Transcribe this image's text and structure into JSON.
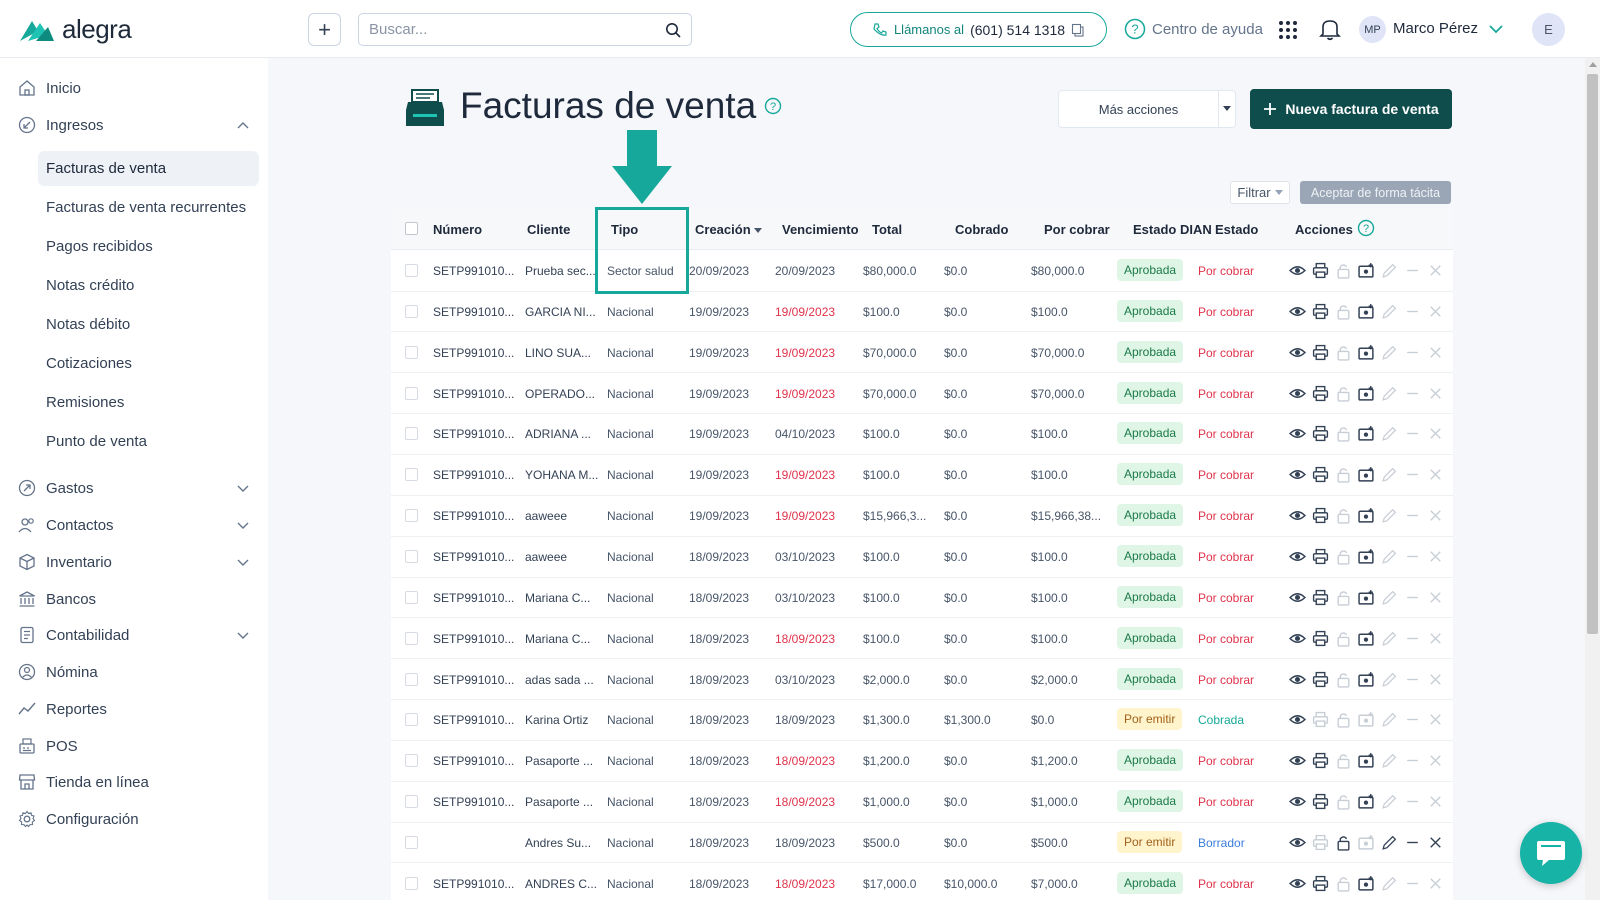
{
  "app": {
    "brand": "alegra"
  },
  "topbar": {
    "search_placeholder": "Buscar...",
    "call_label": "Llámanos al",
    "call_number": "(601) 514 1318",
    "help_label": "Centro de ayuda",
    "user_initials": "MP",
    "user_name": "Marco Pérez",
    "avatar_initial": "E"
  },
  "sidebar": {
    "items": [
      {
        "label": "Inicio",
        "icon": "home-icon"
      },
      {
        "label": "Ingresos",
        "icon": "income-icon",
        "expanded": true
      },
      {
        "label": "Gastos",
        "icon": "expense-icon"
      },
      {
        "label": "Contactos",
        "icon": "contacts-icon"
      },
      {
        "label": "Inventario",
        "icon": "inventory-icon"
      },
      {
        "label": "Bancos",
        "icon": "bank-icon"
      },
      {
        "label": "Contabilidad",
        "icon": "accounting-icon"
      },
      {
        "label": "Nómina",
        "icon": "payroll-icon"
      },
      {
        "label": "Reportes",
        "icon": "reports-icon"
      },
      {
        "label": "POS",
        "icon": "pos-icon"
      },
      {
        "label": "Tienda en línea",
        "icon": "store-icon"
      },
      {
        "label": "Configuración",
        "icon": "settings-icon"
      }
    ],
    "sub_items": [
      "Facturas de venta",
      "Facturas de venta recurrentes",
      "Pagos recibidos",
      "Notas crédito",
      "Notas débito",
      "Cotizaciones",
      "Remisiones",
      "Punto de venta"
    ],
    "active_sub": "Facturas de venta"
  },
  "page": {
    "title": "Facturas de venta",
    "more_actions": "Más acciones",
    "new_invoice": "Nueva factura de venta",
    "filter": "Filtrar",
    "tacit": "Aceptar de forma tácita"
  },
  "table": {
    "headers": [
      "Número",
      "Cliente",
      "Tipo",
      "Creación",
      "Vencimiento",
      "Total",
      "Cobrado",
      "Por cobrar",
      "Estado DIAN",
      "Estado",
      "Acciones"
    ],
    "rows": [
      {
        "numero": "SETP991010...",
        "cliente": "Prueba sec...",
        "tipo": "Sector salud",
        "creacion": "20/09/2023",
        "vencimiento": "20/09/2023",
        "venc_overdue": false,
        "total": "$80,000.0",
        "cobrado": "$0.0",
        "por_cobrar": "$80,000.0",
        "dian": "Aprobada",
        "estado": "Por cobrar"
      },
      {
        "numero": "SETP991010...",
        "cliente": "GARCIA NI...",
        "tipo": "Nacional",
        "creacion": "19/09/2023",
        "vencimiento": "19/09/2023",
        "venc_overdue": true,
        "total": "$100.0",
        "cobrado": "$0.0",
        "por_cobrar": "$100.0",
        "dian": "Aprobada",
        "estado": "Por cobrar"
      },
      {
        "numero": "SETP991010...",
        "cliente": "LINO SUA...",
        "tipo": "Nacional",
        "creacion": "19/09/2023",
        "vencimiento": "19/09/2023",
        "venc_overdue": true,
        "total": "$70,000.0",
        "cobrado": "$0.0",
        "por_cobrar": "$70,000.0",
        "dian": "Aprobada",
        "estado": "Por cobrar"
      },
      {
        "numero": "SETP991010...",
        "cliente": "OPERADO...",
        "tipo": "Nacional",
        "creacion": "19/09/2023",
        "vencimiento": "19/09/2023",
        "venc_overdue": true,
        "total": "$70,000.0",
        "cobrado": "$0.0",
        "por_cobrar": "$70,000.0",
        "dian": "Aprobada",
        "estado": "Por cobrar"
      },
      {
        "numero": "SETP991010...",
        "cliente": "ADRIANA ...",
        "tipo": "Nacional",
        "creacion": "19/09/2023",
        "vencimiento": "04/10/2023",
        "venc_overdue": false,
        "total": "$100.0",
        "cobrado": "$0.0",
        "por_cobrar": "$100.0",
        "dian": "Aprobada",
        "estado": "Por cobrar"
      },
      {
        "numero": "SETP991010...",
        "cliente": "YOHANA M...",
        "tipo": "Nacional",
        "creacion": "19/09/2023",
        "vencimiento": "19/09/2023",
        "venc_overdue": true,
        "total": "$100.0",
        "cobrado": "$0.0",
        "por_cobrar": "$100.0",
        "dian": "Aprobada",
        "estado": "Por cobrar"
      },
      {
        "numero": "SETP991010...",
        "cliente": "aaweee",
        "tipo": "Nacional",
        "creacion": "19/09/2023",
        "vencimiento": "19/09/2023",
        "venc_overdue": true,
        "total": "$15,966,3...",
        "cobrado": "$0.0",
        "por_cobrar": "$15,966,38...",
        "dian": "Aprobada",
        "estado": "Por cobrar"
      },
      {
        "numero": "SETP991010...",
        "cliente": "aaweee",
        "tipo": "Nacional",
        "creacion": "18/09/2023",
        "vencimiento": "03/10/2023",
        "venc_overdue": false,
        "total": "$100.0",
        "cobrado": "$0.0",
        "por_cobrar": "$100.0",
        "dian": "Aprobada",
        "estado": "Por cobrar"
      },
      {
        "numero": "SETP991010...",
        "cliente": "Mariana C...",
        "tipo": "Nacional",
        "creacion": "18/09/2023",
        "vencimiento": "03/10/2023",
        "venc_overdue": false,
        "total": "$100.0",
        "cobrado": "$0.0",
        "por_cobrar": "$100.0",
        "dian": "Aprobada",
        "estado": "Por cobrar"
      },
      {
        "numero": "SETP991010...",
        "cliente": "Mariana C...",
        "tipo": "Nacional",
        "creacion": "18/09/2023",
        "vencimiento": "18/09/2023",
        "venc_overdue": true,
        "total": "$100.0",
        "cobrado": "$0.0",
        "por_cobrar": "$100.0",
        "dian": "Aprobada",
        "estado": "Por cobrar"
      },
      {
        "numero": "SETP991010...",
        "cliente": "adas sada ...",
        "tipo": "Nacional",
        "creacion": "18/09/2023",
        "vencimiento": "03/10/2023",
        "venc_overdue": false,
        "total": "$2,000.0",
        "cobrado": "$0.0",
        "por_cobrar": "$2,000.0",
        "dian": "Aprobada",
        "estado": "Por cobrar"
      },
      {
        "numero": "SETP991010...",
        "cliente": "Karina Ortiz",
        "tipo": "Nacional",
        "creacion": "18/09/2023",
        "vencimiento": "18/09/2023",
        "venc_overdue": false,
        "total": "$1,300.0",
        "cobrado": "$1,300.0",
        "por_cobrar": "$0.0",
        "dian": "Por emitir",
        "estado": "Cobrada"
      },
      {
        "numero": "SETP991010...",
        "cliente": "Pasaporte ...",
        "tipo": "Nacional",
        "creacion": "18/09/2023",
        "vencimiento": "18/09/2023",
        "venc_overdue": true,
        "total": "$1,200.0",
        "cobrado": "$0.0",
        "por_cobrar": "$1,200.0",
        "dian": "Aprobada",
        "estado": "Por cobrar"
      },
      {
        "numero": "SETP991010...",
        "cliente": "Pasaporte ...",
        "tipo": "Nacional",
        "creacion": "18/09/2023",
        "vencimiento": "18/09/2023",
        "venc_overdue": true,
        "total": "$1,000.0",
        "cobrado": "$0.0",
        "por_cobrar": "$1,000.0",
        "dian": "Aprobada",
        "estado": "Por cobrar"
      },
      {
        "numero": "",
        "cliente": "Andres Su...",
        "tipo": "Nacional",
        "creacion": "18/09/2023",
        "vencimiento": "18/09/2023",
        "venc_overdue": false,
        "total": "$500.0",
        "cobrado": "$0.0",
        "por_cobrar": "$500.0",
        "dian": "Por emitir",
        "estado": "Borrador"
      },
      {
        "numero": "SETP991010...",
        "cliente": "ANDRES C...",
        "tipo": "Nacional",
        "creacion": "18/09/2023",
        "vencimiento": "18/09/2023",
        "venc_overdue": true,
        "total": "$17,000.0",
        "cobrado": "$10,000.0",
        "por_cobrar": "$7,000.0",
        "dian": "Aprobada",
        "estado": "Por cobrar"
      }
    ]
  },
  "colors": {
    "brand": "#16a89a",
    "primary_dark": "#0f4c4c",
    "overdue": "#e0334b",
    "approved_bg": "#dff5e6",
    "pending_bg": "#fff4cc"
  }
}
